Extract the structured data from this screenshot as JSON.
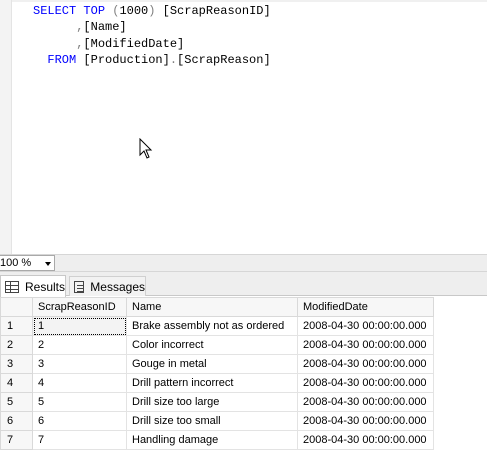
{
  "editor": {
    "lines": [
      [
        {
          "t": "SELECT",
          "c": "kw"
        },
        {
          "t": " "
        },
        {
          "t": "TOP",
          "c": "kw"
        },
        {
          "t": " "
        },
        {
          "t": "(",
          "c": "gr"
        },
        {
          "t": "1000"
        },
        {
          "t": ")",
          "c": "gr"
        },
        {
          "t": " [ScrapReasonID]"
        }
      ],
      [
        {
          "t": "      "
        },
        {
          "t": ",",
          "c": "gr"
        },
        {
          "t": "[Name]"
        }
      ],
      [
        {
          "t": "      "
        },
        {
          "t": ",",
          "c": "gr"
        },
        {
          "t": "[ModifiedDate]"
        }
      ],
      [
        {
          "t": "  "
        },
        {
          "t": "FROM",
          "c": "kw"
        },
        {
          "t": " [Production]"
        },
        {
          "t": ".",
          "c": "gr"
        },
        {
          "t": "[ScrapReason]"
        }
      ]
    ]
  },
  "zoom": {
    "value": "100 %"
  },
  "tabs": {
    "results_label": "Results",
    "messages_label": "Messages"
  },
  "results": {
    "columns": [
      "ScrapReasonID",
      "Name",
      "ModifiedDate"
    ],
    "rows": [
      {
        "n": "1",
        "cells": [
          "1",
          "Brake assembly not as ordered",
          "2008-04-30 00:00:00.000"
        ]
      },
      {
        "n": "2",
        "cells": [
          "2",
          "Color incorrect",
          "2008-04-30 00:00:00.000"
        ]
      },
      {
        "n": "3",
        "cells": [
          "3",
          "Gouge in metal",
          "2008-04-30 00:00:00.000"
        ]
      },
      {
        "n": "4",
        "cells": [
          "4",
          "Drill pattern incorrect",
          "2008-04-30 00:00:00.000"
        ]
      },
      {
        "n": "5",
        "cells": [
          "5",
          "Drill size too large",
          "2008-04-30 00:00:00.000"
        ]
      },
      {
        "n": "6",
        "cells": [
          "6",
          "Drill size too small",
          "2008-04-30 00:00:00.000"
        ]
      },
      {
        "n": "7",
        "cells": [
          "7",
          "Handling damage",
          "2008-04-30 00:00:00.000"
        ]
      }
    ]
  }
}
